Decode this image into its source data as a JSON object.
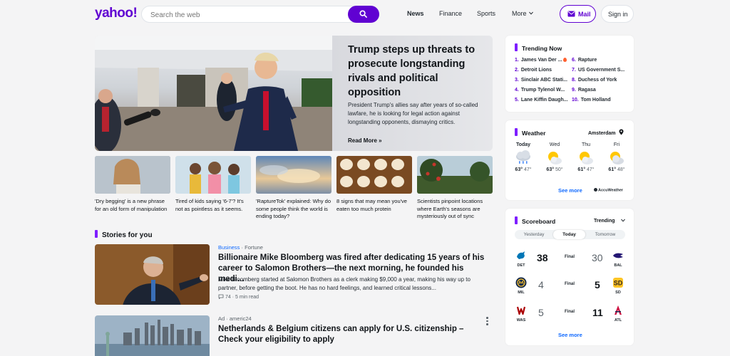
{
  "header": {
    "logo": "yahoo!",
    "search_placeholder": "Search the web",
    "nav": [
      "News",
      "Finance",
      "Sports",
      "More"
    ],
    "mail_label": "Mail",
    "signin_label": "Sign in"
  },
  "hero": {
    "title": "Trump steps up threats to prosecute longstanding rivals and political opposition",
    "description": "President Trump's allies say after years of so-called lawfare, he is looking for legal action against longstanding opponents, dismaying critics.",
    "read_more": "Read More »"
  },
  "thumbs": [
    {
      "caption": "'Dry begging' is a new phrase for an old form of manipulation"
    },
    {
      "caption": "Tired of kids saying '6-7'? It's not as pointless as it seems."
    },
    {
      "caption": "'RaptureTok' explained: Why do some people think the world is ending today?"
    },
    {
      "caption": "8 signs that may mean you've eaten too much protein"
    },
    {
      "caption": "Scientists pinpoint locations where Earth's seasons are mysteriously out of sync"
    }
  ],
  "stories_title": "Stories for you",
  "stories": [
    {
      "category": "Business",
      "source": "Fortune",
      "title": "Billionaire Mike Bloomberg was fired after dedicating 15 years of his career to Salomon Brothers—the next morning, he founded his medi...",
      "description": "Mike Bloomberg started at Salomon Brothers as a clerk making $9,000 a year, making his way up to partner, before getting the boot. He has no hard feelings, and learned critical lessons...",
      "comments": "74",
      "read_time": "5 min read"
    },
    {
      "category": "Ad",
      "source": "americ24",
      "title": "Netherlands & Belgium citizens can apply for U.S. citizenship – Check your eligibility to apply"
    }
  ],
  "trending": {
    "title": "Trending Now",
    "items": [
      {
        "n": "1.",
        "label": "James Van Der ..."
      },
      {
        "n": "2.",
        "label": "Detroit Lions"
      },
      {
        "n": "3.",
        "label": "Sinclair ABC Stati..."
      },
      {
        "n": "4.",
        "label": "Trump Tylenol W..."
      },
      {
        "n": "5.",
        "label": "Lane Kiffin Daugh..."
      },
      {
        "n": "6.",
        "label": "Rapture"
      },
      {
        "n": "7.",
        "label": "US Government S..."
      },
      {
        "n": "8.",
        "label": "Duchess of York"
      },
      {
        "n": "9.",
        "label": "Ragasa"
      },
      {
        "n": "10.",
        "label": "Tom Holland"
      }
    ]
  },
  "weather": {
    "title": "Weather",
    "location": "Amsterdam",
    "days": [
      {
        "day": "Today",
        "hi": "63°",
        "lo": "47°",
        "icon": "rain-cloud-icon"
      },
      {
        "day": "Wed",
        "hi": "63°",
        "lo": "50°",
        "icon": "partly-sunny-icon"
      },
      {
        "day": "Thu",
        "hi": "61°",
        "lo": "47°",
        "icon": "partly-sunny-icon"
      },
      {
        "day": "Fri",
        "hi": "61°",
        "lo": "48°",
        "icon": "partly-sunny-icon"
      }
    ],
    "see_more": "See more",
    "provider": "AccuWeather"
  },
  "scoreboard": {
    "title": "Scoreboard",
    "dropdown": "Trending",
    "tabs": [
      "Yesterday",
      "Today",
      "Tomorrow"
    ],
    "games": [
      {
        "left": "DET",
        "left_score": "38",
        "status": "Final",
        "right_score": "30",
        "right": "BAL",
        "left_color": "#0076b6",
        "right_color": "#241773"
      },
      {
        "left": "MIL",
        "left_score": "4",
        "status": "Final",
        "right_score": "5",
        "right": "SD",
        "left_color": "#12284b",
        "right_color": "#ffc425"
      },
      {
        "left": "WAS",
        "left_score": "5",
        "status": "Final",
        "right_score": "11",
        "right": "ATL",
        "left_color": "#ab0003",
        "right_color": "#ce1141"
      }
    ],
    "see_more": "See more"
  },
  "colors": {
    "brand": "#6001d2",
    "accent_bar": "#7e1fff",
    "link": "#0f69ff"
  }
}
